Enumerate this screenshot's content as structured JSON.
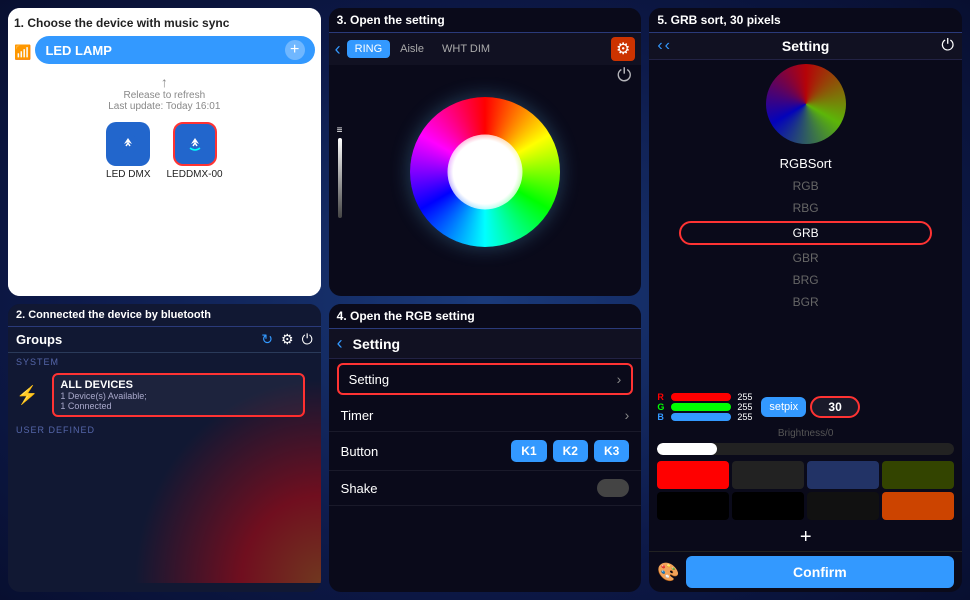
{
  "panels": {
    "panel1": {
      "header": "1. Choose the device with music sync",
      "bar_label": "LED LAMP",
      "plus": "+",
      "refresh_hint": "Release to refresh",
      "last_update": "Last update: Today 16:01",
      "devices": [
        {
          "name": "LED DMX",
          "icon": "🔵"
        },
        {
          "name": "LEDDMX-00",
          "icon": "🔵",
          "selected": true
        }
      ]
    },
    "panel2": {
      "header": "2. Connected the device by bluetooth",
      "groups_title": "Groups",
      "system_label": "SYSTEM",
      "all_devices_title": "ALL DEVICES",
      "all_devices_sub": "1 Device(s) Available;\n1 Connected",
      "user_defined_label": "USER DEFINED"
    },
    "panel3": {
      "header": "3. Open the setting",
      "tabs": [
        "RING",
        "Aisle",
        "WHT DIM"
      ],
      "active_tab": "RING"
    },
    "panel4": {
      "header": "4. Open the RGB setting",
      "title": "Setting",
      "rows": [
        {
          "label": "Setting",
          "type": "arrow",
          "highlighted": true
        },
        {
          "label": "Timer",
          "type": "arrow"
        },
        {
          "label": "Button",
          "type": "buttons",
          "buttons": [
            "K1",
            "K2",
            "K3"
          ]
        },
        {
          "label": "Shake",
          "type": "toggle"
        }
      ]
    },
    "panel5": {
      "header": "5. GRB sort, 30 pixels",
      "title": "Setting",
      "sort_title": "RGBSort",
      "sort_options": [
        "RGB",
        "RBG",
        "GRB",
        "GBR",
        "BRG",
        "BGR"
      ],
      "selected_sort": "GRB",
      "rgb_values": {
        "r": 255,
        "g": 255,
        "b": 255
      },
      "setpix_label": "setpix",
      "pix_value": "30",
      "brightness_label": "Brightness/0",
      "swatches": [
        "#ff0000",
        "#333333",
        "#223366",
        "#334400",
        "#000000",
        "#000000",
        "#000000",
        "#cc4400"
      ],
      "confirm_label": "Confirm"
    }
  }
}
